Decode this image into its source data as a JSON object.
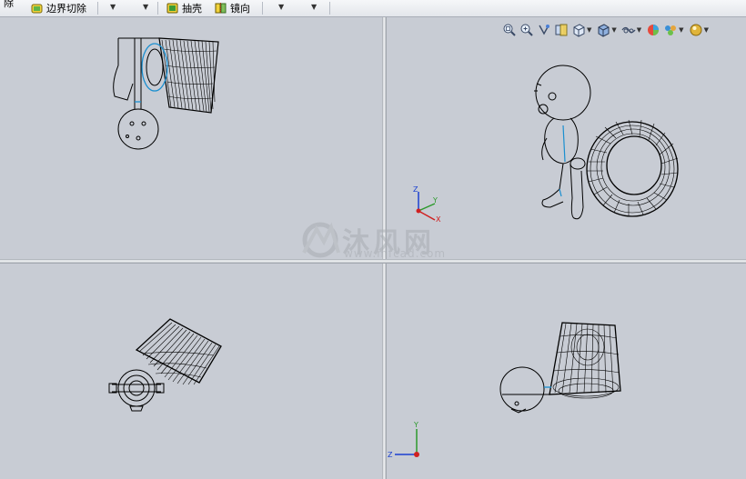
{
  "toolbar": {
    "partial_label": "除",
    "boundary_cut_label": "边界切除",
    "shell_label": "抽壳",
    "mirror_label": "镜向"
  },
  "watermark": {
    "text": "沐风网",
    "url": "www.mfcad.com"
  },
  "triad_top": {
    "x": "X",
    "y": "Y",
    "z": "Z"
  },
  "triad_bottom": {
    "y": "Y",
    "z": "Z"
  },
  "icons": {
    "hud": [
      "zoom-to-fit-icon",
      "zoom-area-icon",
      "previous-view-icon",
      "section-view-icon",
      "view-orientation-icon",
      "display-style-icon",
      "hide-show-icon",
      "edit-appearance-icon",
      "apply-scene-icon",
      "view-settings-icon"
    ]
  },
  "colors": {
    "viewport_bg": "#c8ccd4",
    "model_line": "#000000",
    "accent_line": "#1a8fd0"
  }
}
